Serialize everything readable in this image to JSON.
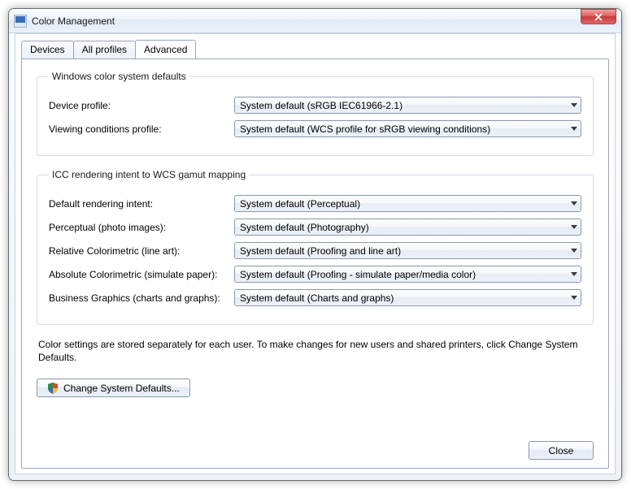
{
  "title": "Color Management",
  "tabs": {
    "devices": "Devices",
    "all_profiles": "All profiles",
    "advanced": "Advanced"
  },
  "group1": {
    "legend": "Windows color system defaults",
    "device_profile": {
      "label": "Device profile:",
      "value": "System default (sRGB IEC61966-2.1)"
    },
    "viewing_conditions": {
      "label": "Viewing conditions profile:",
      "value": "System default (WCS profile for sRGB viewing conditions)"
    }
  },
  "group2": {
    "legend": "ICC  rendering intent to WCS gamut mapping",
    "default_intent": {
      "label": "Default rendering intent:",
      "value": "System default (Perceptual)"
    },
    "perceptual": {
      "label": "Perceptual (photo images):",
      "value": "System default (Photography)"
    },
    "relative": {
      "label": "Relative Colorimetric (line art):",
      "value": "System default (Proofing and line art)"
    },
    "absolute": {
      "label": "Absolute Colorimetric (simulate paper):",
      "value": "System default (Proofing - simulate paper/media color)"
    },
    "business": {
      "label": "Business Graphics (charts and graphs):",
      "value": "System default (Charts and graphs)"
    }
  },
  "note": "Color settings are stored separately for each user. To make changes for new users and shared printers, click Change System Defaults.",
  "buttons": {
    "change_defaults": "Change System Defaults...",
    "close": "Close"
  }
}
